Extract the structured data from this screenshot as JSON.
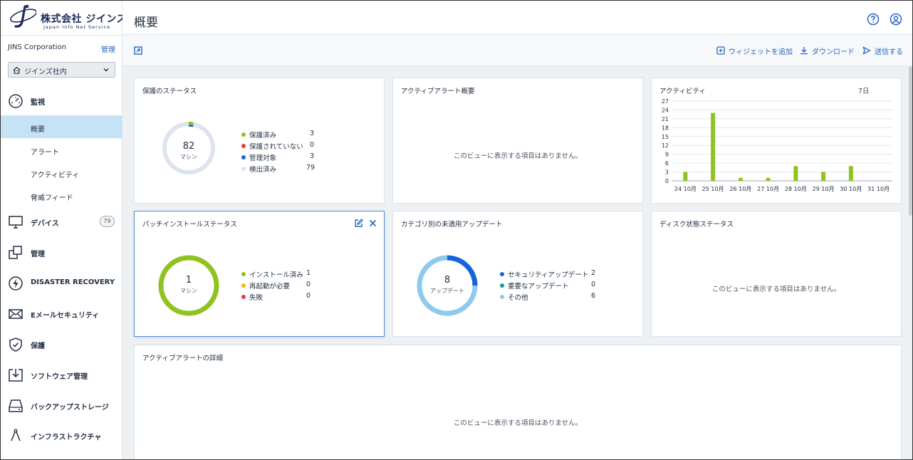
{
  "brand": {
    "name": "株式会社 ジインズ",
    "sub": "Japan Info Net Service"
  },
  "sidebar": {
    "org_name": "JINS Corporation",
    "org_manage": "管理",
    "tenant": "ジインズ社内",
    "items": [
      {
        "label": "監視"
      },
      {
        "label": "概要"
      },
      {
        "label": "アラート"
      },
      {
        "label": "アクティビティ"
      },
      {
        "label": "脅威フィード"
      },
      {
        "label": "デバイス",
        "badge": "79"
      },
      {
        "label": "管理"
      },
      {
        "label": "DISASTER RECOVERY"
      },
      {
        "label": "Eメールセキュリティ"
      },
      {
        "label": "保護"
      },
      {
        "label": "ソフトウェア管理"
      },
      {
        "label": "バックアップストレージ"
      },
      {
        "label": "インフラストラクチャ"
      }
    ]
  },
  "header": {
    "title": "概要"
  },
  "toolbar": {
    "add_widget": "ウィジェットを追加",
    "download": "ダウンロード",
    "send": "送信する"
  },
  "cards": {
    "protection": {
      "title": "保護のステータス",
      "center_value": "82",
      "center_unit": "マシン",
      "legend": [
        {
          "label": "保護済み",
          "value": "3",
          "color": "#8fc31f"
        },
        {
          "label": "保護されていない",
          "value": "0",
          "color": "#e8383d"
        },
        {
          "label": "管理対象",
          "value": "3",
          "color": "#1f63d6"
        },
        {
          "label": "検出済み",
          "value": "79",
          "color": "#dde4ee"
        }
      ]
    },
    "active_alerts": {
      "title": "アクティブアラート概要",
      "empty": "このビューに表示する項目はありません。"
    },
    "activity": {
      "title": "アクティビティ",
      "period": "7日"
    },
    "patch": {
      "title": "パッチインストールステータス",
      "center_value": "1",
      "center_unit": "マシン",
      "legend": [
        {
          "label": "インストール済み",
          "value": "1",
          "color": "#8fc31f"
        },
        {
          "label": "再起動が必要",
          "value": "0",
          "color": "#f5b800"
        },
        {
          "label": "失敗",
          "value": "0",
          "color": "#e8383d"
        }
      ]
    },
    "updates": {
      "title": "カテゴリ別の未適用アップデート",
      "center_value": "8",
      "center_unit": "アップデート",
      "legend": [
        {
          "label": "セキュリティアップデート",
          "value": "2",
          "color": "#1565d8"
        },
        {
          "label": "重要なアップデート",
          "value": "0",
          "color": "#11a08f"
        },
        {
          "label": "その他",
          "value": "6",
          "color": "#8ec9ee"
        }
      ]
    },
    "disk": {
      "title": "ディスク状態ステータス",
      "empty": "このビューに表示する項目はありません。"
    },
    "alert_details": {
      "title": "アクティブアラートの詳細",
      "empty": "このビューに表示する項目はありません。"
    }
  },
  "chart_data": {
    "type": "bar",
    "categories": [
      "24 10月",
      "25 10月",
      "26 10月",
      "27 10月",
      "28 10月",
      "29 10月",
      "30 10月",
      "31 10月"
    ],
    "values": [
      3,
      23,
      1,
      1,
      5,
      3,
      5,
      0
    ],
    "yticks": [
      "0",
      "3",
      "6",
      "9",
      "12",
      "15",
      "18",
      "21",
      "24",
      "27"
    ],
    "ylim": [
      0,
      27
    ],
    "color": "#8fc31f",
    "grid": true
  },
  "colors": {
    "accent": "#2668c5",
    "active_nav": "#c6e2f5",
    "chart_bar": "#8fc31f"
  }
}
